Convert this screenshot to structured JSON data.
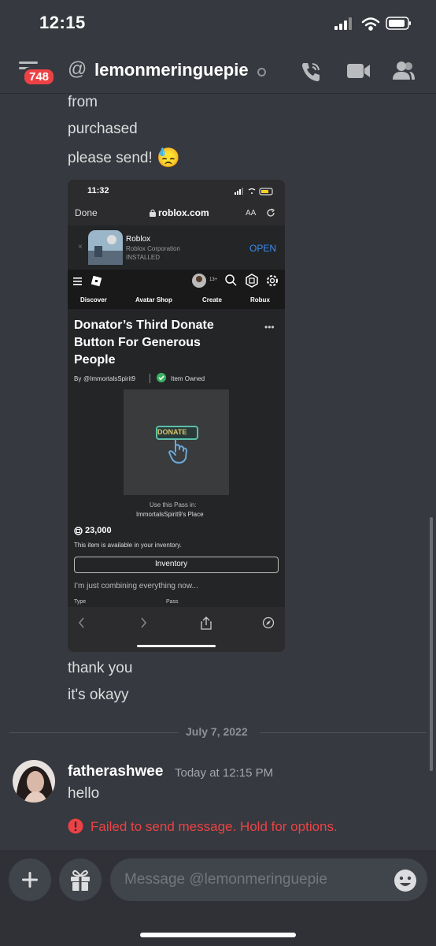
{
  "status_bar": {
    "time": "12:15"
  },
  "header": {
    "badge_count": "748",
    "at_symbol": "@",
    "username": "lemonmeringuepie",
    "icons": [
      "phone-call-icon",
      "video-camera-icon",
      "members-icon"
    ]
  },
  "messages_top": [
    "from",
    "purchased",
    "please send!"
  ],
  "emoji": "😓",
  "screenshot": {
    "time": "11:32",
    "done": "Done",
    "url": "roblox.com",
    "aa": "AA",
    "app_name": "Roblox",
    "app_company": "Roblox Corporation",
    "app_status": "INSTALLED",
    "open": "OPEN",
    "age": "13+",
    "nav": [
      "Discover",
      "Avatar Shop",
      "Create",
      "Robux"
    ],
    "title_lines": [
      "Donator’s Third Donate",
      "Button For Generous",
      "People"
    ],
    "by": "By",
    "creator": "@ImmortalsSpirit9",
    "owned": "Item Owned",
    "donate_text": "DONATE",
    "use_pass": "Use this Pass in:",
    "place": "ImmortalsSpirit9's Place",
    "price": "23,000",
    "available": "This item is available in your inventory.",
    "inventory_button": "Inventory",
    "description": "I’m just combining everything now...",
    "type_label": "Type",
    "type_value": "Pass"
  },
  "messages_after": [
    "thank you",
    "it's okayy"
  ],
  "date_divider": "July 7, 2022",
  "message": {
    "author": "fatherashwee",
    "timestamp": "Today at 12:15 PM",
    "text": "hello",
    "error": "Failed to send message. Hold for options."
  },
  "composer": {
    "placeholder": "Message @lemonmeringuepie"
  },
  "colors": {
    "background": "#36393f",
    "error": "#ed4245",
    "composer": "#2f3136"
  }
}
